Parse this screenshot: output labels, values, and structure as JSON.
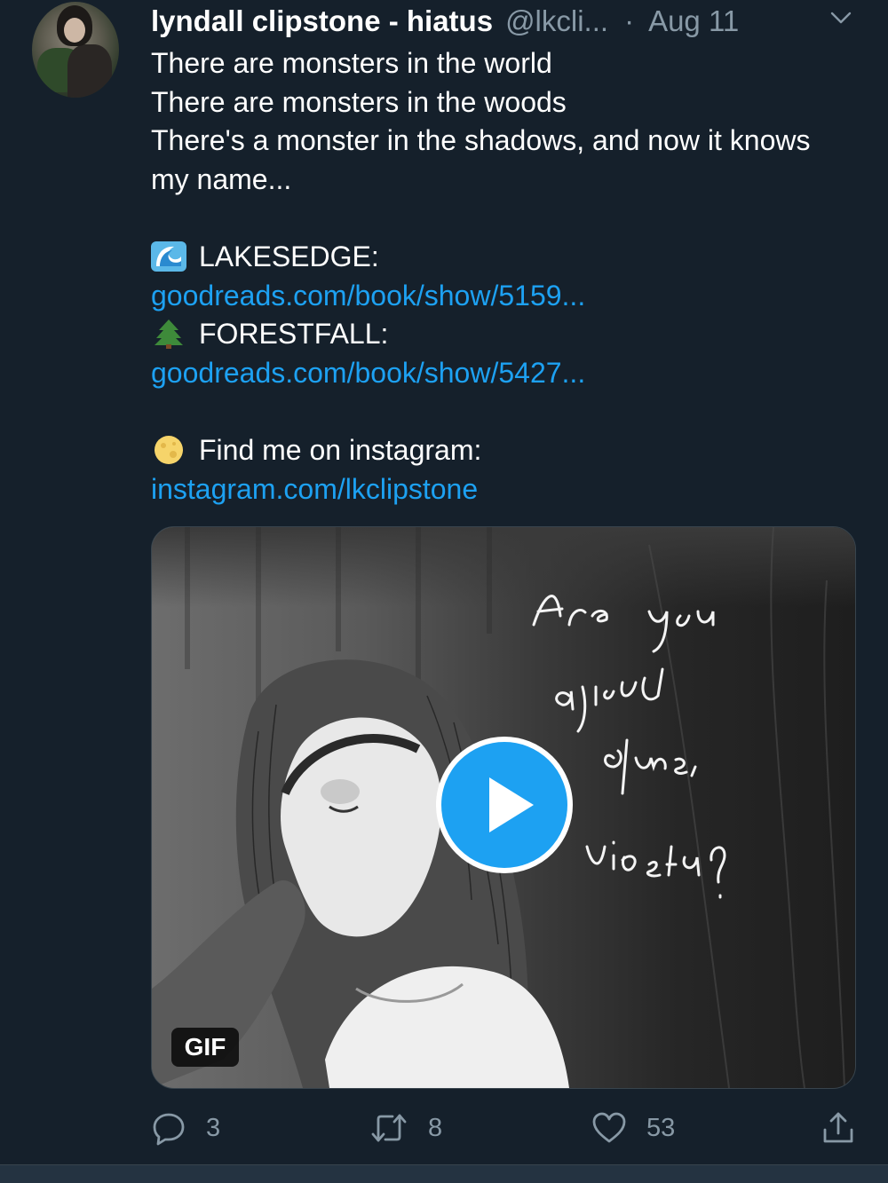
{
  "tweet": {
    "author_name": "lyndall clipstone - hiatus",
    "handle": "@lkcli...",
    "separator": "·",
    "date": "Aug 11",
    "lines": [
      "There are monsters in the world",
      "There are monsters in the woods",
      "There's a monster in the shadows, and now it knows my name..."
    ],
    "lakesedge_label": "LAKESEDGE:",
    "lakesedge_link": "goodreads.com/book/show/5159...",
    "forestfall_label": "FORESTFALL:",
    "forestfall_link": "goodreads.com/book/show/5427...",
    "instagram_label": "Find me on instagram:",
    "instagram_link": "instagram.com/lkclipstone",
    "emoji": {
      "lakesedge": "wave-emoji",
      "forestfall": "evergreen-tree-emoji",
      "instagram": "moon-emoji"
    }
  },
  "media": {
    "type": "gif",
    "badge": "GIF",
    "caption_art": "Are you afraid of me, Violeta?"
  },
  "actions": {
    "reply_count": "3",
    "retweet_count": "8",
    "like_count": "53"
  },
  "colors": {
    "background": "#15202b",
    "link": "#1da1f2",
    "muted": "#8899a6",
    "play_button": "#1da1f2"
  }
}
